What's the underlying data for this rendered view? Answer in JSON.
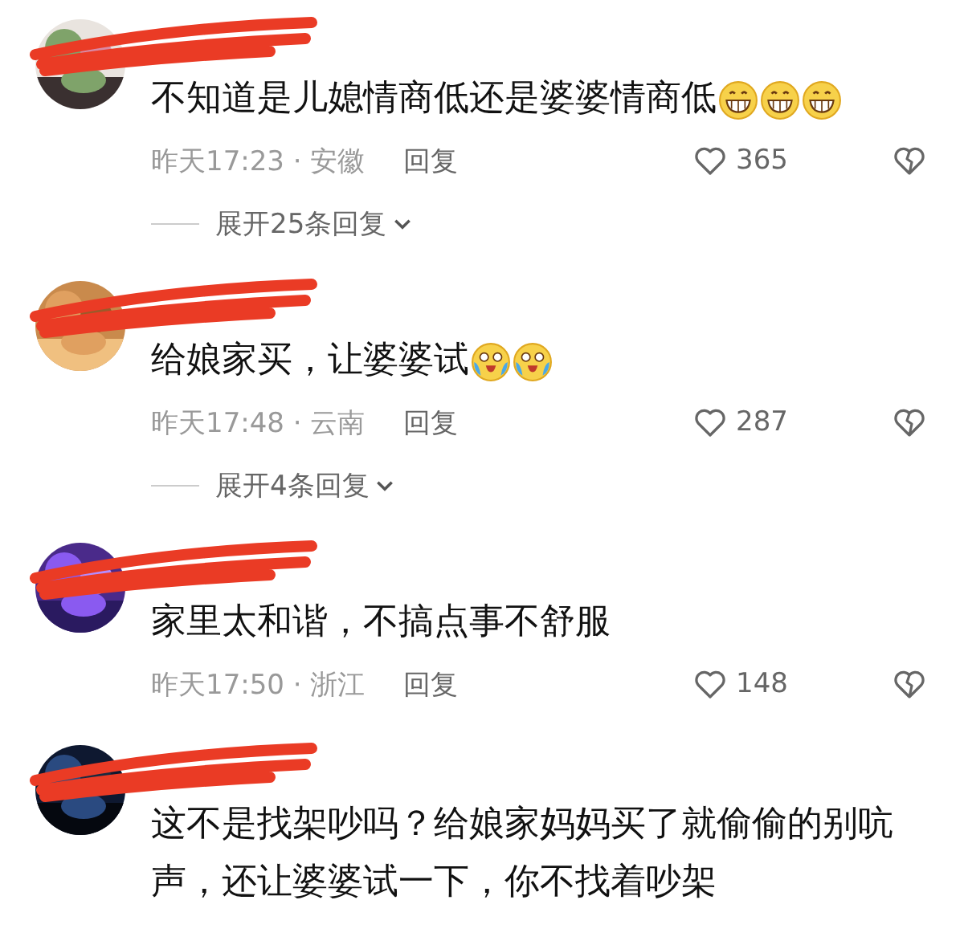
{
  "comments": [
    {
      "text": "不知道是儿媳情商低还是婆婆情商低",
      "emojis": [
        {
          "kind": "grin"
        },
        {
          "kind": "grin"
        },
        {
          "kind": "grin"
        }
      ],
      "time": "昨天17:23 · 安徽",
      "reply": "回复",
      "likes": "365",
      "expand": "展开25条回复"
    },
    {
      "text": "给娘家买，让婆婆试",
      "emojis": [
        {
          "kind": "tears"
        },
        {
          "kind": "tears"
        }
      ],
      "time": "昨天17:48 · 云南",
      "reply": "回复",
      "likes": "287",
      "expand": "展开4条回复"
    },
    {
      "text": "家里太和谐，不搞点事不舒服",
      "time": "昨天17:50 · 浙江",
      "reply": "回复",
      "likes": "148"
    },
    {
      "text": "这不是找架吵吗？给娘家妈妈买了就偷偷的别吭声，还让婆婆试一下，你不找着吵架"
    }
  ]
}
